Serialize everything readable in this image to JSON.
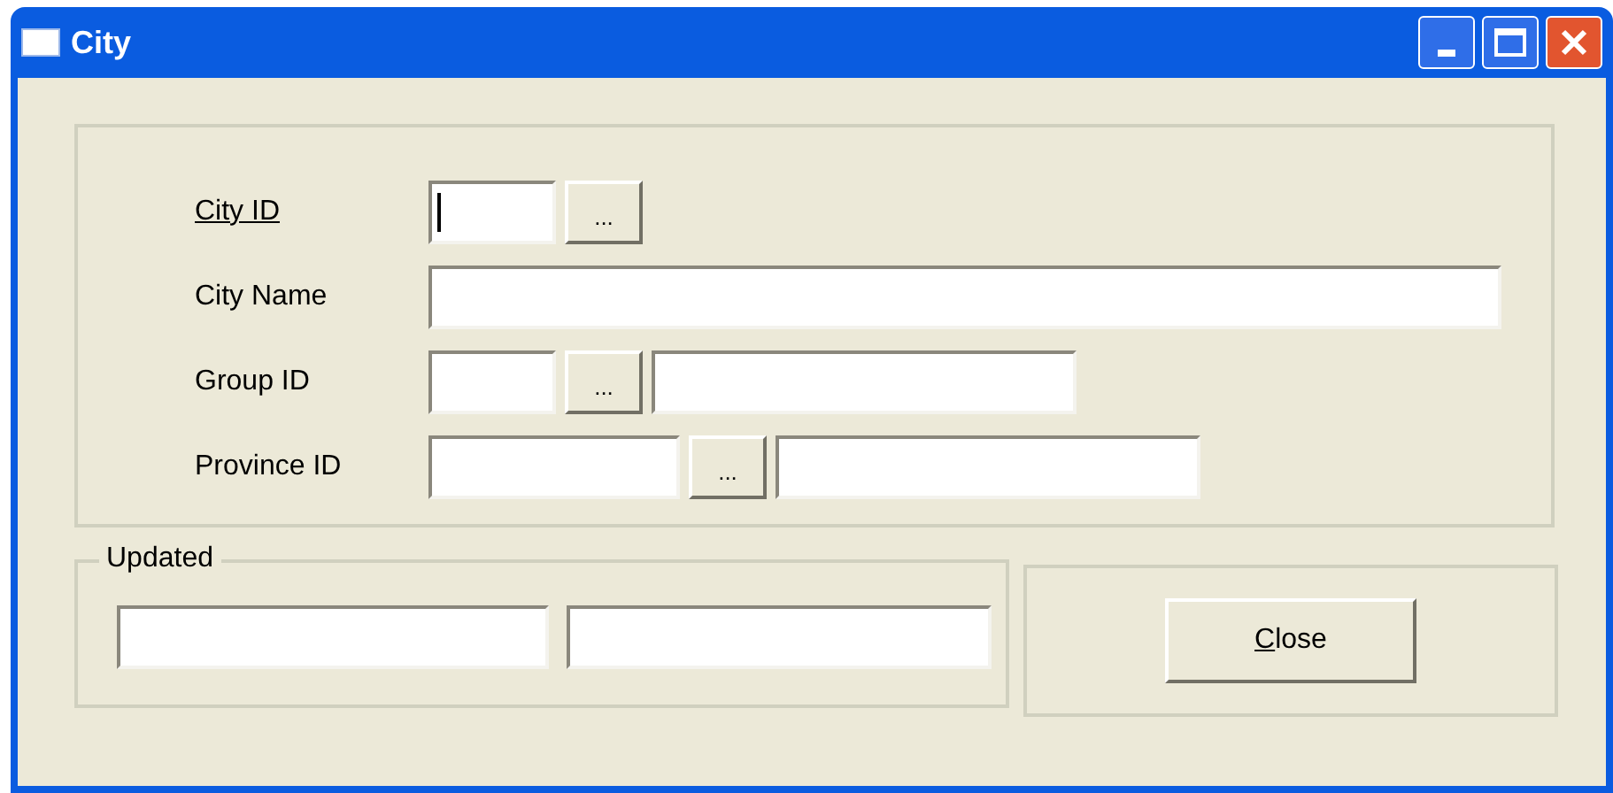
{
  "window": {
    "title": "City"
  },
  "fields": [
    {
      "label": "City ID",
      "underlined": true,
      "parts": [
        {
          "kind": "input",
          "focused": true
        },
        {
          "kind": "browse",
          "text": "..."
        }
      ]
    },
    {
      "label": "City Name",
      "underlined": false,
      "parts": [
        {
          "kind": "input",
          "focused": false
        }
      ]
    },
    {
      "label": "Group ID",
      "underlined": false,
      "parts": [
        {
          "kind": "input",
          "focused": false
        },
        {
          "kind": "browse",
          "text": "..."
        },
        {
          "kind": "input",
          "focused": false
        }
      ]
    },
    {
      "label": "Province ID",
      "underlined": false,
      "parts": [
        {
          "kind": "input",
          "focused": false
        },
        {
          "kind": "browse",
          "text": "..."
        },
        {
          "kind": "input",
          "focused": false
        }
      ]
    }
  ],
  "updated": {
    "legend": "Updated",
    "fields": [
      {
        "focused": false
      },
      {
        "focused": false
      }
    ]
  },
  "close_button": {
    "access_key": "C",
    "rest": "lose"
  }
}
